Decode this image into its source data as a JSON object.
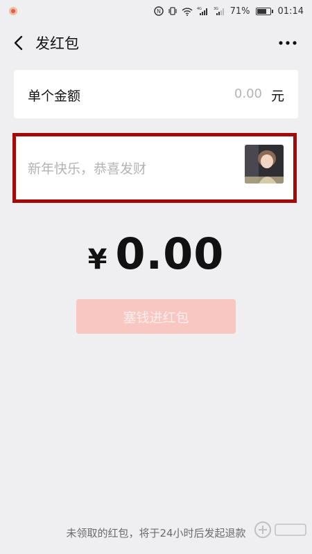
{
  "status_bar": {
    "network_4g": "4G",
    "network_3g": "3G",
    "battery_percent": "71%",
    "battery_level": 0.71,
    "time": "01:14"
  },
  "nav": {
    "title": "发红包"
  },
  "amount": {
    "label": "单个金额",
    "placeholder": "0.00",
    "unit": "元"
  },
  "message": {
    "placeholder": "新年快乐，恭喜发财"
  },
  "total": {
    "currency": "¥",
    "value": "0.00"
  },
  "button": {
    "label": "塞钱进红包"
  },
  "footer": {
    "note": "未领取的红包，将于24小时后发起退款"
  },
  "colors": {
    "highlight_border": "#a30b0b",
    "button_disabled": "#f8c7c2",
    "background": "#efeff2"
  }
}
